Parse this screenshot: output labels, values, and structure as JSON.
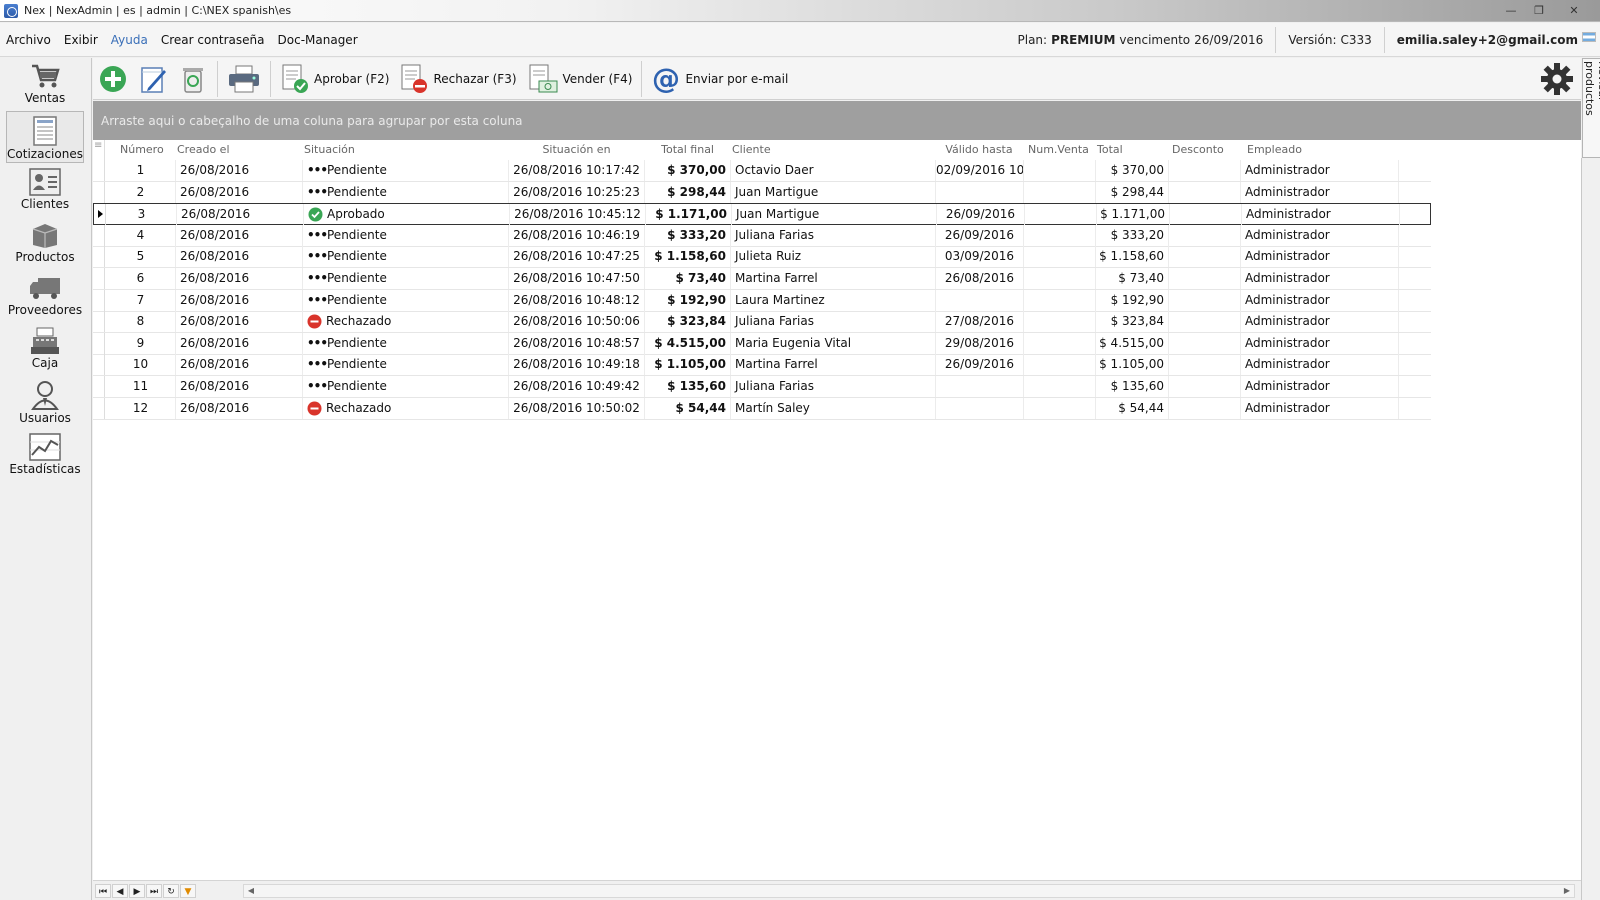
{
  "window": {
    "title": "Nex | NexAdmin | es | admin | C:\\NEX spanish\\es"
  },
  "menu": {
    "items": [
      "Archivo",
      "Exibir",
      "Ayuda",
      "Crear contraseña",
      "Doc-Manager"
    ],
    "plan_label": "Plan:",
    "plan_value": "PREMIUM",
    "expiry_label": "vencimento",
    "expiry_value": "26/09/2016",
    "version_label": "Versión:",
    "version_value": "C333",
    "user_email": "emilia.saley+2@gmail.com"
  },
  "sidebar": {
    "items": [
      "Ventas",
      "Cotizaciones",
      "Clientes",
      "Productos",
      "Proveedores",
      "Caja",
      "Usuarios",
      "Estadísticas"
    ],
    "selected": "Cotizaciones"
  },
  "toolbar": {
    "approve": "Aprobar (F2)",
    "reject": "Rechazar (F3)",
    "sell": "Vender (F4)",
    "email": "Enviar por e-mail"
  },
  "side_tab": "Revisar productos",
  "group_panel": "Arraste aqui o cabeçalho de uma coluna para agrupar por esta coluna",
  "table": {
    "columns": [
      "Número",
      "Creado el",
      "Situación",
      "Situación en",
      "Total final",
      "Cliente",
      "Válido hasta",
      "Num.Venta",
      "Total",
      "Desconto",
      "Empleado"
    ],
    "rows": [
      [
        "1",
        "26/08/2016",
        "Pendiente",
        "26/08/2016 10:17:42",
        "$ 370,00",
        "Octavio Daer",
        "02/09/2016 10",
        "",
        "$ 370,00",
        "",
        "Administrador"
      ],
      [
        "2",
        "26/08/2016",
        "Pendiente",
        "26/08/2016 10:25:23",
        "$ 298,44",
        "Juan Martigue",
        "",
        "",
        "$ 298,44",
        "",
        "Administrador"
      ],
      [
        "3",
        "26/08/2016",
        "Aprobado",
        "26/08/2016 10:45:12",
        "$ 1.171,00",
        "Juan Martigue",
        "26/09/2016",
        "",
        "$ 1.171,00",
        "",
        "Administrador"
      ],
      [
        "4",
        "26/08/2016",
        "Pendiente",
        "26/08/2016 10:46:19",
        "$ 333,20",
        "Juliana Farias",
        "26/09/2016",
        "",
        "$ 333,20",
        "",
        "Administrador"
      ],
      [
        "5",
        "26/08/2016",
        "Pendiente",
        "26/08/2016 10:47:25",
        "$ 1.158,60",
        "Julieta Ruiz",
        "03/09/2016",
        "",
        "$ 1.158,60",
        "",
        "Administrador"
      ],
      [
        "6",
        "26/08/2016",
        "Pendiente",
        "26/08/2016 10:47:50",
        "$ 73,40",
        "Martina Farrel",
        "26/08/2016",
        "",
        "$ 73,40",
        "",
        "Administrador"
      ],
      [
        "7",
        "26/08/2016",
        "Pendiente",
        "26/08/2016 10:48:12",
        "$ 192,90",
        "Laura Martinez",
        "",
        "",
        "$ 192,90",
        "",
        "Administrador"
      ],
      [
        "8",
        "26/08/2016",
        "Rechazado",
        "26/08/2016 10:50:06",
        "$ 323,84",
        "Juliana Farias",
        "27/08/2016",
        "",
        "$ 323,84",
        "",
        "Administrador"
      ],
      [
        "9",
        "26/08/2016",
        "Pendiente",
        "26/08/2016 10:48:57",
        "$ 4.515,00",
        "Maria Eugenia Vital",
        "29/08/2016",
        "",
        "$ 4.515,00",
        "",
        "Administrador"
      ],
      [
        "10",
        "26/08/2016",
        "Pendiente",
        "26/08/2016 10:49:18",
        "$ 1.105,00",
        "Martina Farrel",
        "26/09/2016",
        "",
        "$ 1.105,00",
        "",
        "Administrador"
      ],
      [
        "11",
        "26/08/2016",
        "Pendiente",
        "26/08/2016 10:49:42",
        "$ 135,60",
        "Juliana Farias",
        "",
        "",
        "$ 135,60",
        "",
        "Administrador"
      ],
      [
        "12",
        "26/08/2016",
        "Rechazado",
        "26/08/2016 10:50:02",
        "$ 54,44",
        "Martín Saley",
        "",
        "",
        "$ 54,44",
        "",
        "Administrador"
      ]
    ],
    "focused_row": 3
  },
  "colors": {
    "approved": "#3aa655",
    "rejected": "#d9342b",
    "group_panel": "#9f9f9f",
    "accent": "#3a6fb8"
  },
  "icons": {
    "add": "add-icon",
    "edit": "edit-icon",
    "delete": "recycle-icon",
    "print": "printer-icon",
    "approve": "approve-document-icon",
    "reject": "reject-document-icon",
    "sell": "sell-document-icon",
    "email": "at-sign-icon",
    "settings": "gear-icon"
  }
}
